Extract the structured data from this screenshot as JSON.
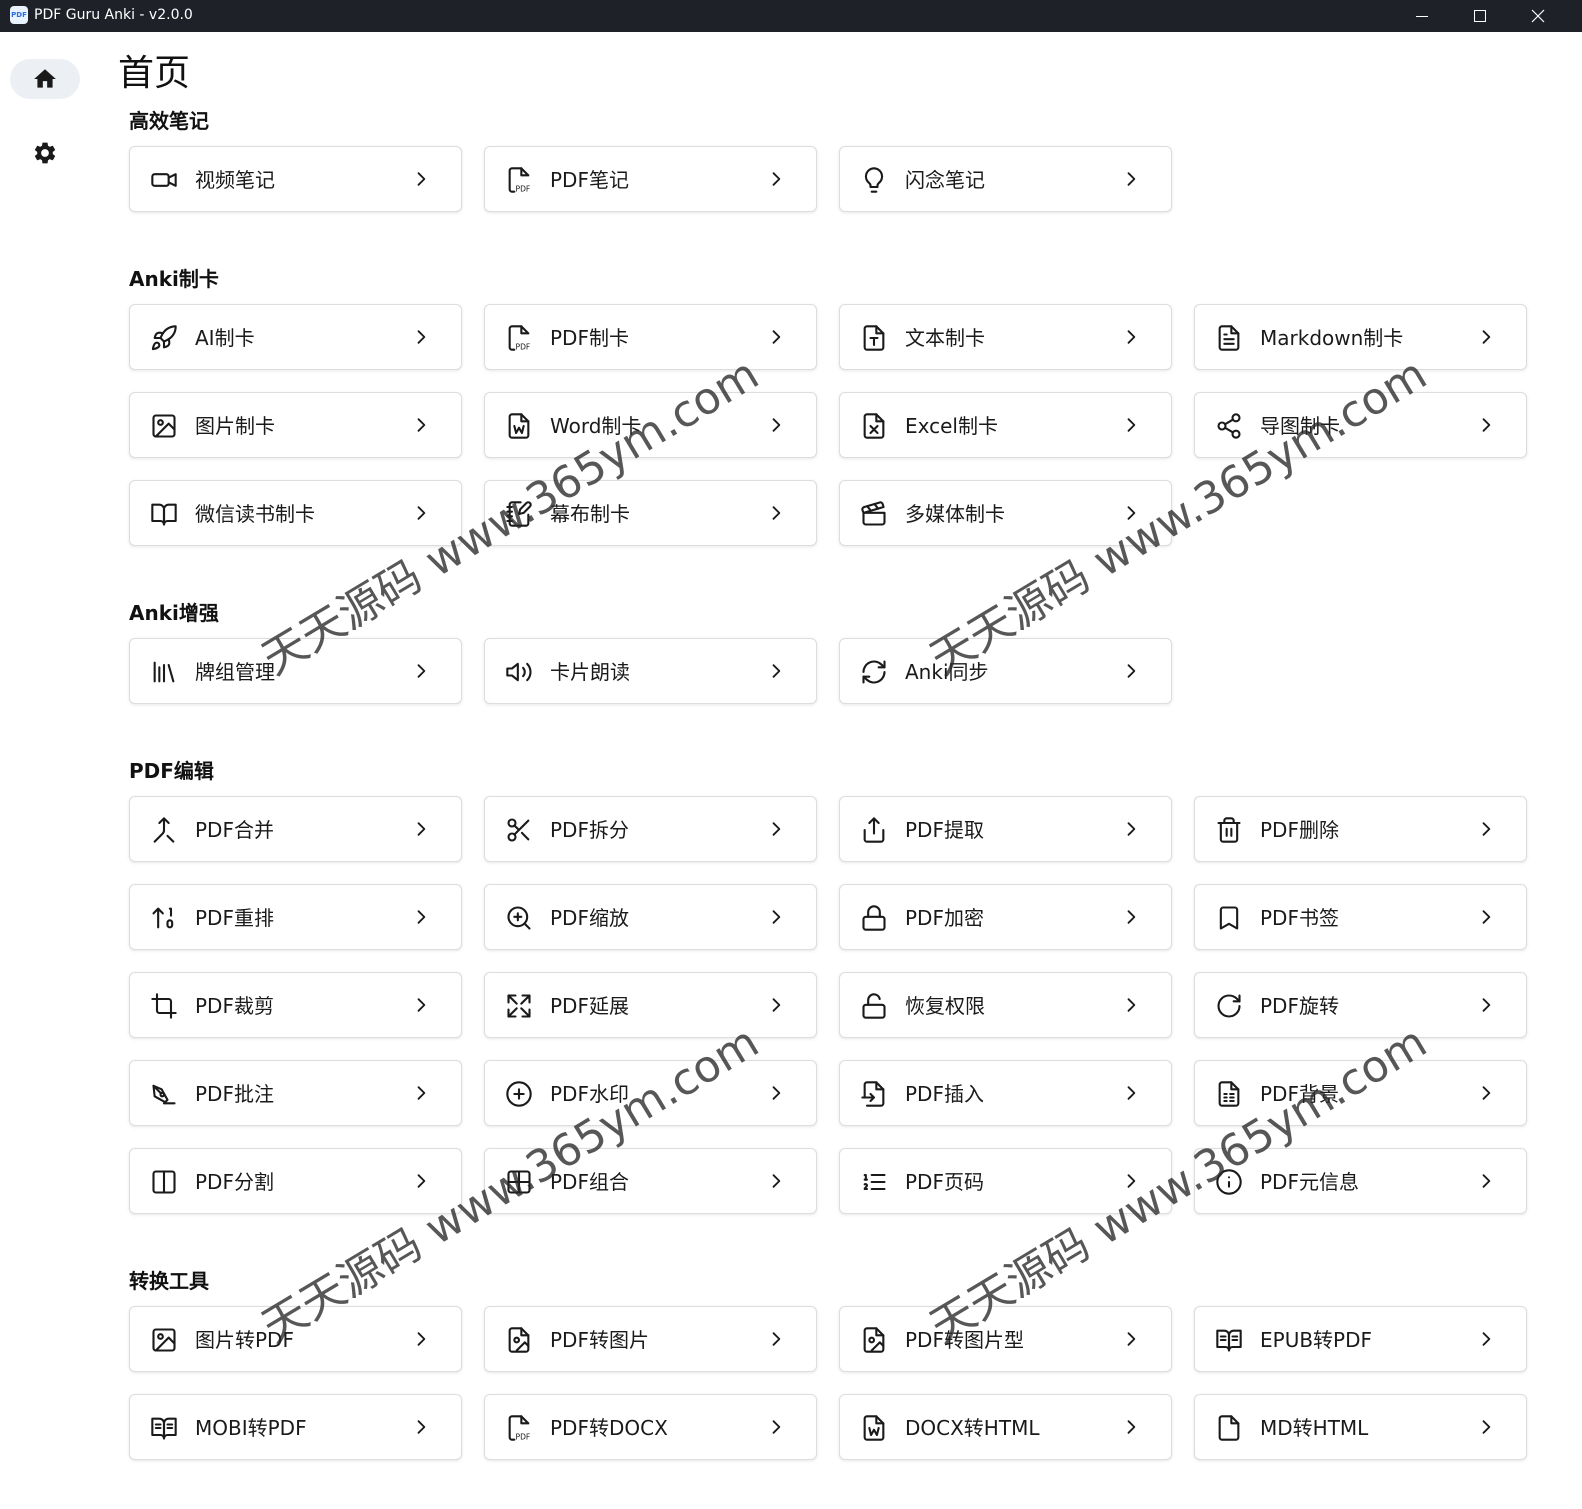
{
  "window": {
    "title": "PDF Guru Anki - v2.0.0",
    "app_icon_text": "PDF"
  },
  "sidebar": {
    "items": [
      {
        "name": "home",
        "icon": "home-icon",
        "active": true
      },
      {
        "name": "settings",
        "icon": "gear-icon",
        "active": false
      }
    ]
  },
  "page": {
    "title": "首页"
  },
  "sections": [
    {
      "title": "高效笔记",
      "cards": [
        {
          "label": "视频笔记",
          "icon": "video"
        },
        {
          "label": "PDF笔记",
          "icon": "pdf-file"
        },
        {
          "label": "闪念笔记",
          "icon": "lightbulb"
        }
      ]
    },
    {
      "title": "Anki制卡",
      "cards": [
        {
          "label": "AI制卡",
          "icon": "rocket"
        },
        {
          "label": "PDF制卡",
          "icon": "pdf-file"
        },
        {
          "label": "文本制卡",
          "icon": "text-file"
        },
        {
          "label": "Markdown制卡",
          "icon": "document"
        },
        {
          "label": "图片制卡",
          "icon": "image"
        },
        {
          "label": "Word制卡",
          "icon": "word-file"
        },
        {
          "label": "Excel制卡",
          "icon": "excel-file"
        },
        {
          "label": "导图制卡",
          "icon": "share"
        },
        {
          "label": "微信读书制卡",
          "icon": "book-open"
        },
        {
          "label": "幕布制卡",
          "icon": "notebook-pen"
        },
        {
          "label": "多媒体制卡",
          "icon": "clapperboard"
        }
      ]
    },
    {
      "title": "Anki增强",
      "cards": [
        {
          "label": "牌组管理",
          "icon": "library"
        },
        {
          "label": "卡片朗读",
          "icon": "speaker"
        },
        {
          "label": "Anki同步",
          "icon": "sync"
        }
      ]
    },
    {
      "title": "PDF编辑",
      "cards": [
        {
          "label": "PDF合并",
          "icon": "merge"
        },
        {
          "label": "PDF拆分",
          "icon": "scissors"
        },
        {
          "label": "PDF提取",
          "icon": "upload"
        },
        {
          "label": "PDF删除",
          "icon": "trash"
        },
        {
          "label": "PDF重排",
          "icon": "sort"
        },
        {
          "label": "PDF缩放",
          "icon": "zoom-in"
        },
        {
          "label": "PDF加密",
          "icon": "lock"
        },
        {
          "label": "PDF书签",
          "icon": "bookmark"
        },
        {
          "label": "PDF裁剪",
          "icon": "crop"
        },
        {
          "label": "PDF延展",
          "icon": "expand"
        },
        {
          "label": "恢复权限",
          "icon": "unlock"
        },
        {
          "label": "PDF旋转",
          "icon": "rotate"
        },
        {
          "label": "PDF批注",
          "icon": "annotate"
        },
        {
          "label": "PDF水印",
          "icon": "plus-circle"
        },
        {
          "label": "PDF插入",
          "icon": "file-import"
        },
        {
          "label": "PDF背景",
          "icon": "file-grid"
        },
        {
          "label": "PDF分割",
          "icon": "columns"
        },
        {
          "label": "PDF组合",
          "icon": "grid"
        },
        {
          "label": "PDF页码",
          "icon": "list-numbered"
        },
        {
          "label": "PDF元信息",
          "icon": "info"
        }
      ]
    },
    {
      "title": "转换工具",
      "cards": [
        {
          "label": "图片转PDF",
          "icon": "image"
        },
        {
          "label": "PDF转图片",
          "icon": "file-image"
        },
        {
          "label": "PDF转图片型",
          "icon": "file-image"
        },
        {
          "label": "EPUB转PDF",
          "icon": "book-text"
        },
        {
          "label": "MOBI转PDF",
          "icon": "book-text"
        },
        {
          "label": "PDF转DOCX",
          "icon": "pdf-file"
        },
        {
          "label": "DOCX转HTML",
          "icon": "word-file"
        },
        {
          "label": "MD转HTML",
          "icon": "blank-file"
        }
      ]
    }
  ],
  "watermark": "天天源码 www.365ym.com"
}
